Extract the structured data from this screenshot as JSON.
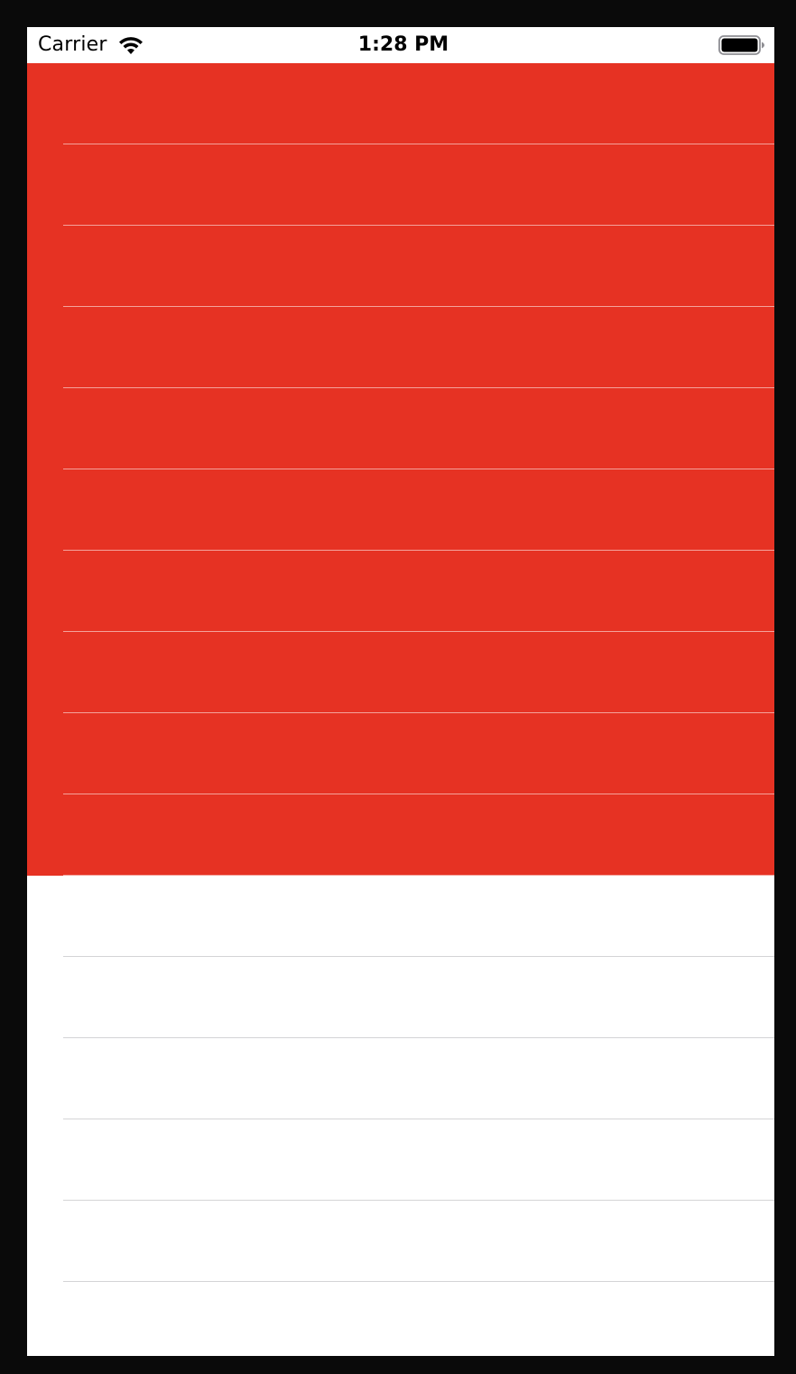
{
  "status_bar": {
    "carrier": "Carrier",
    "time": "1:28 PM",
    "wifi_icon": "wifi-icon",
    "battery_icon": "battery-icon",
    "battery_level": 1.0
  },
  "colors": {
    "highlight": "#e63223",
    "background": "#ffffff",
    "separator_on_highlight": "#f0a49c",
    "separator_plain": "#d4d4d6",
    "bezel": "#0a0a0a"
  },
  "table": {
    "highlighted_cell_count": 10,
    "plain_cell_count": 6
  }
}
